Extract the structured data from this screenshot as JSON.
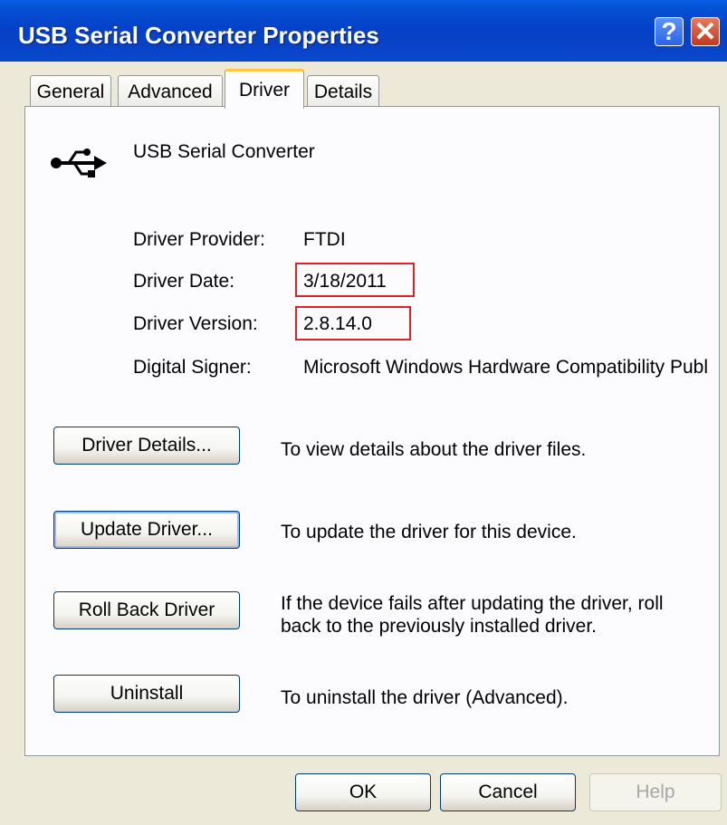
{
  "window": {
    "title": "USB Serial Converter Properties"
  },
  "titlebar": {
    "help_glyph": "?",
    "close_glyph": "✕"
  },
  "tabs": [
    {
      "label": "General"
    },
    {
      "label": "Advanced"
    },
    {
      "label": "Driver",
      "active": true
    },
    {
      "label": "Details"
    }
  ],
  "device": {
    "icon": "usb-icon",
    "name": "USB Serial Converter"
  },
  "info": [
    {
      "label": "Driver Provider:",
      "value": "FTDI"
    },
    {
      "label": "Driver Date:",
      "value": "3/18/2011",
      "highlighted": true
    },
    {
      "label": "Driver Version:",
      "value": "2.8.14.0",
      "highlighted": true
    },
    {
      "label": "Digital Signer:",
      "value": "Microsoft Windows Hardware Compatibility Publ"
    }
  ],
  "actions": [
    {
      "button": "Driver Details...",
      "description": "To view details about the driver files."
    },
    {
      "button": "Update Driver...",
      "description": "To update the driver for this device."
    },
    {
      "button": "Roll Back Driver",
      "description_line1": "If the device fails after updating the driver, roll",
      "description_line2": "back to the previously installed driver."
    },
    {
      "button": "Uninstall",
      "description": "To uninstall the driver (Advanced)."
    }
  ],
  "footer": {
    "ok": "OK",
    "cancel": "Cancel",
    "help": "Help"
  },
  "colors": {
    "highlight_border": "#E2202A",
    "titlebar": "#0441C9",
    "dialog_bg": "#ECE9D8"
  }
}
